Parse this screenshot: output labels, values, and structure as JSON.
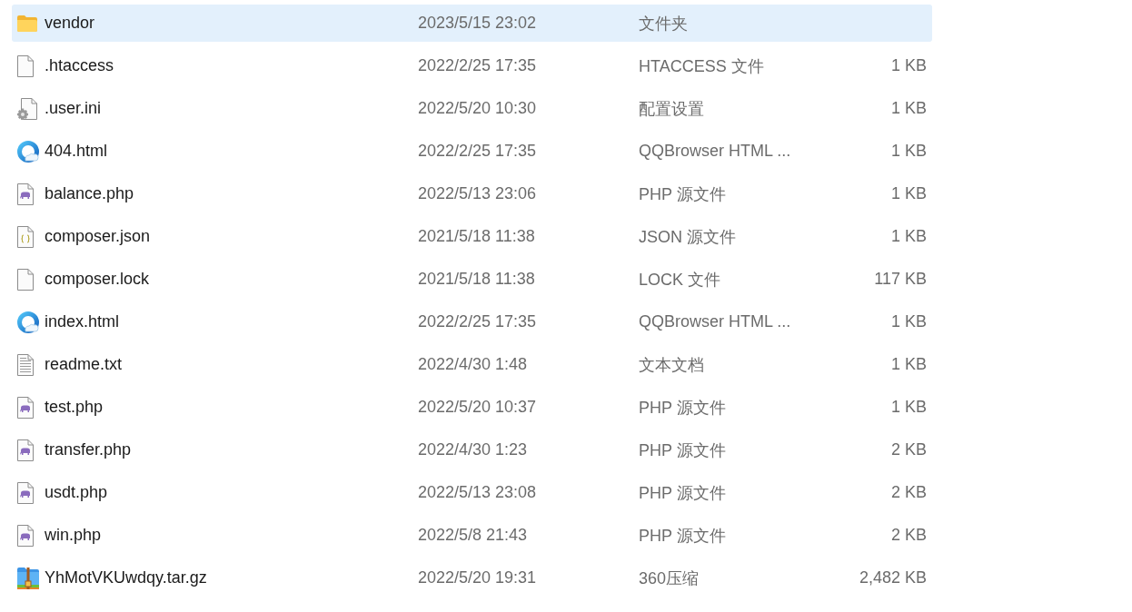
{
  "files": [
    {
      "kind": "folder",
      "name": "vendor",
      "modified": "2023/5/15 23:02",
      "type": "文件夹",
      "selected": true
    },
    {
      "kind": "file",
      "name": ".htaccess",
      "modified": "2022/2/25 17:35",
      "type": "HTACCESS 文件",
      "size": "1 KB",
      "selected": false
    },
    {
      "kind": "settings",
      "name": ".user.ini",
      "modified": "2022/5/20 10:30",
      "type": "配置设置",
      "size": "1 KB",
      "selected": false
    },
    {
      "kind": "browser",
      "name": "404.html",
      "modified": "2022/2/25 17:35",
      "type": "QQBrowser HTML ...",
      "size": "1 KB",
      "selected": false
    },
    {
      "kind": "php",
      "name": "balance.php",
      "modified": "2022/5/13 23:06",
      "type": "PHP 源文件",
      "size": "1 KB",
      "selected": false
    },
    {
      "kind": "json",
      "name": "composer.json",
      "modified": "2021/5/18 11:38",
      "type": "JSON 源文件",
      "size": "1 KB",
      "selected": false
    },
    {
      "kind": "file",
      "name": "composer.lock",
      "modified": "2021/5/18 11:38",
      "type": "LOCK 文件",
      "size": "117 KB",
      "selected": false
    },
    {
      "kind": "browser",
      "name": "index.html",
      "modified": "2022/2/25 17:35",
      "type": "QQBrowser HTML ...",
      "size": "1 KB",
      "selected": false
    },
    {
      "kind": "text",
      "name": "readme.txt",
      "modified": "2022/4/30 1:48",
      "type": "文本文档",
      "size": "1 KB",
      "selected": false
    },
    {
      "kind": "php",
      "name": "test.php",
      "modified": "2022/5/20 10:37",
      "type": "PHP 源文件",
      "size": "1 KB",
      "selected": false
    },
    {
      "kind": "php",
      "name": "transfer.php",
      "modified": "2022/4/30 1:23",
      "type": "PHP 源文件",
      "size": "2 KB",
      "selected": false
    },
    {
      "kind": "php",
      "name": "usdt.php",
      "modified": "2022/5/13 23:08",
      "type": "PHP 源文件",
      "size": "2 KB",
      "selected": false
    },
    {
      "kind": "php",
      "name": "win.php",
      "modified": "2022/5/8 21:43",
      "type": "PHP 源文件",
      "size": "2 KB",
      "selected": false
    },
    {
      "kind": "archive",
      "name": "YhMotVKUwdqy.tar.gz",
      "modified": "2022/5/20 19:31",
      "type": "360压缩",
      "size": "2,482 KB",
      "selected": false
    }
  ]
}
